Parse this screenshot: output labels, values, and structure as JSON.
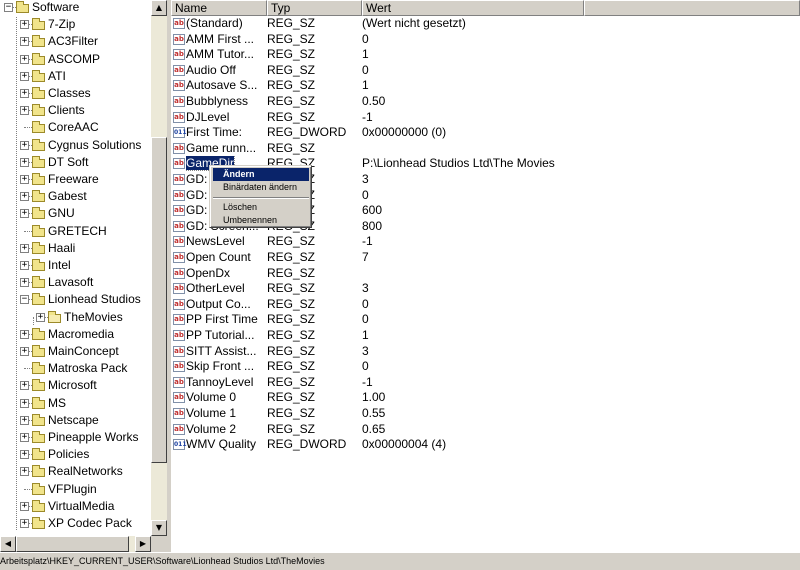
{
  "tree": {
    "items": [
      {
        "label": "Software",
        "depth": 0,
        "expander": "minus",
        "open": false
      },
      {
        "label": "7-Zip",
        "depth": 1,
        "expander": "plus"
      },
      {
        "label": "AC3Filter",
        "depth": 1,
        "expander": "plus"
      },
      {
        "label": "ASCOMP",
        "depth": 1,
        "expander": "plus"
      },
      {
        "label": "ATI",
        "depth": 1,
        "expander": "plus"
      },
      {
        "label": "Classes",
        "depth": 1,
        "expander": "plus"
      },
      {
        "label": "Clients",
        "depth": 1,
        "expander": "plus"
      },
      {
        "label": "CoreAAC",
        "depth": 1,
        "expander": "none"
      },
      {
        "label": "Cygnus Solutions",
        "depth": 1,
        "expander": "plus"
      },
      {
        "label": "DT Soft",
        "depth": 1,
        "expander": "plus"
      },
      {
        "label": "Freeware",
        "depth": 1,
        "expander": "plus"
      },
      {
        "label": "Gabest",
        "depth": 1,
        "expander": "plus"
      },
      {
        "label": "GNU",
        "depth": 1,
        "expander": "plus"
      },
      {
        "label": "GRETECH",
        "depth": 1,
        "expander": "none"
      },
      {
        "label": "Haali",
        "depth": 1,
        "expander": "plus"
      },
      {
        "label": "Intel",
        "depth": 1,
        "expander": "plus"
      },
      {
        "label": "Lavasoft",
        "depth": 1,
        "expander": "plus"
      },
      {
        "label": "Lionhead Studios",
        "depth": 1,
        "expander": "minus"
      },
      {
        "label": "TheMovies",
        "depth": 2,
        "expander": "plus",
        "open": true
      },
      {
        "label": "Macromedia",
        "depth": 1,
        "expander": "plus"
      },
      {
        "label": "MainConcept",
        "depth": 1,
        "expander": "plus"
      },
      {
        "label": "Matroska Pack",
        "depth": 1,
        "expander": "none"
      },
      {
        "label": "Microsoft",
        "depth": 1,
        "expander": "plus"
      },
      {
        "label": "MS",
        "depth": 1,
        "expander": "plus"
      },
      {
        "label": "Netscape",
        "depth": 1,
        "expander": "plus"
      },
      {
        "label": "Pineapple Works",
        "depth": 1,
        "expander": "plus"
      },
      {
        "label": "Policies",
        "depth": 1,
        "expander": "plus"
      },
      {
        "label": "RealNetworks",
        "depth": 1,
        "expander": "plus"
      },
      {
        "label": "VFPlugin",
        "depth": 1,
        "expander": "none"
      },
      {
        "label": "VirtualMedia",
        "depth": 1,
        "expander": "plus"
      },
      {
        "label": "XP Codec Pack",
        "depth": 1,
        "expander": "plus"
      }
    ]
  },
  "list": {
    "headers": {
      "name": "Name",
      "type": "Typ",
      "data": "Wert"
    },
    "rows": [
      {
        "name": "(Standard)",
        "type": "REG_SZ",
        "data": "(Wert nicht gesetzt)",
        "kind": "sz"
      },
      {
        "name": "AMM First ...",
        "type": "REG_SZ",
        "data": "0",
        "kind": "sz"
      },
      {
        "name": "AMM Tutor...",
        "type": "REG_SZ",
        "data": "1",
        "kind": "sz"
      },
      {
        "name": "Audio Off",
        "type": "REG_SZ",
        "data": "0",
        "kind": "sz"
      },
      {
        "name": "Autosave S...",
        "type": "REG_SZ",
        "data": "1",
        "kind": "sz"
      },
      {
        "name": "Bubblyness",
        "type": "REG_SZ",
        "data": "0.50",
        "kind": "sz"
      },
      {
        "name": "DJLevel",
        "type": "REG_SZ",
        "data": "-1",
        "kind": "sz"
      },
      {
        "name": "First Time:",
        "type": "REG_DWORD",
        "data": "0x00000000 (0)",
        "kind": "bin"
      },
      {
        "name": "Game runn...",
        "type": "REG_SZ",
        "data": "",
        "kind": "sz"
      },
      {
        "name": "GameDir",
        "type": "REG_SZ",
        "data": "P:\\Lionhead Studios Ltd\\The Movies",
        "kind": "sz",
        "selected": true
      },
      {
        "name": "GD:",
        "type": "REG_SZ",
        "data": "3",
        "kind": "sz"
      },
      {
        "name": "GD:",
        "type": "REG_SZ",
        "data": "0",
        "kind": "sz"
      },
      {
        "name": "GD:",
        "type": "REG_SZ",
        "data": "600",
        "kind": "sz"
      },
      {
        "name": "GD: Screen...",
        "type": "REG_SZ",
        "data": "800",
        "kind": "sz"
      },
      {
        "name": "NewsLevel",
        "type": "REG_SZ",
        "data": "-1",
        "kind": "sz"
      },
      {
        "name": "Open Count",
        "type": "REG_SZ",
        "data": "7",
        "kind": "sz"
      },
      {
        "name": "OpenDx",
        "type": "REG_SZ",
        "data": "",
        "kind": "sz"
      },
      {
        "name": "OtherLevel",
        "type": "REG_SZ",
        "data": "3",
        "kind": "sz"
      },
      {
        "name": "Output Co...",
        "type": "REG_SZ",
        "data": "0",
        "kind": "sz"
      },
      {
        "name": "PP First Time",
        "type": "REG_SZ",
        "data": "0",
        "kind": "sz"
      },
      {
        "name": "PP Tutorial...",
        "type": "REG_SZ",
        "data": "1",
        "kind": "sz"
      },
      {
        "name": "SITT Assist...",
        "type": "REG_SZ",
        "data": "3",
        "kind": "sz"
      },
      {
        "name": "Skip Front ...",
        "type": "REG_SZ",
        "data": "0",
        "kind": "sz"
      },
      {
        "name": "TannoyLevel",
        "type": "REG_SZ",
        "data": "-1",
        "kind": "sz"
      },
      {
        "name": "Volume 0",
        "type": "REG_SZ",
        "data": "1.00",
        "kind": "sz"
      },
      {
        "name": "Volume 1",
        "type": "REG_SZ",
        "data": "0.55",
        "kind": "sz"
      },
      {
        "name": "Volume 2",
        "type": "REG_SZ",
        "data": "0.65",
        "kind": "sz"
      },
      {
        "name": "WMV Quality",
        "type": "REG_DWORD",
        "data": "0x00000004 (4)",
        "kind": "bin"
      }
    ]
  },
  "context_menu": {
    "items": [
      {
        "label": "Ändern",
        "highlighted": true
      },
      {
        "label": "Binärdaten ändern"
      },
      {
        "separator": true
      },
      {
        "label": "Löschen"
      },
      {
        "label": "Umbenennen"
      }
    ]
  },
  "status_bar": {
    "path": "Arbeitsplatz\\HKEY_CURRENT_USER\\Software\\Lionhead Studios Ltd\\TheMovies"
  },
  "icons": {
    "sz_icon": "ab",
    "dword_icon": "011",
    "folder": "folder-icon"
  },
  "colors": {
    "selection": "#0a246a",
    "window_bg": "#d4d0c8",
    "string_icon": "#c03030",
    "binary_icon": "#1a3fa0"
  }
}
